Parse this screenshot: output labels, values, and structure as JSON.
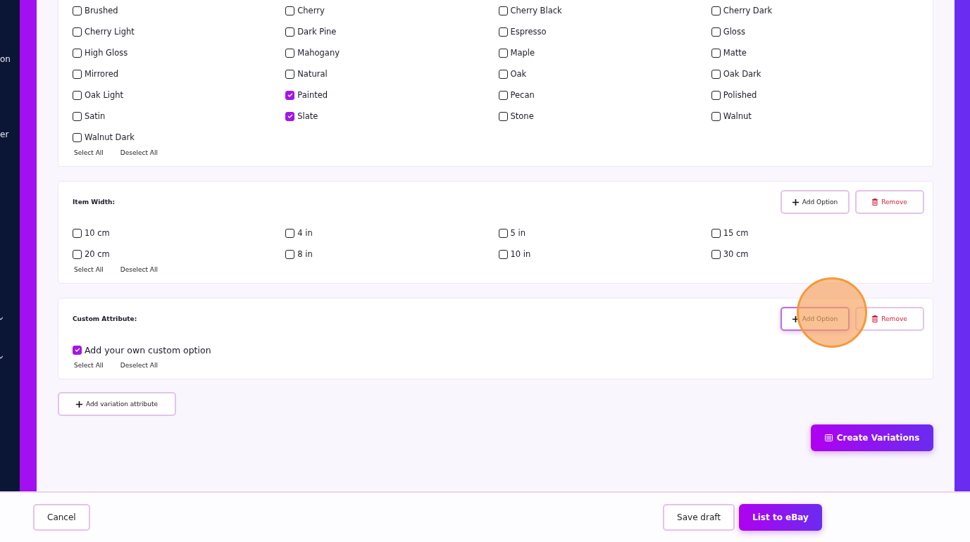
{
  "sidebar": {
    "items": [
      {
        "kind": "text",
        "label": "on"
      },
      {
        "kind": "text",
        "label": "er"
      },
      {
        "kind": "chevron"
      },
      {
        "kind": "chevron"
      }
    ]
  },
  "sections": [
    {
      "options": [
        {
          "label": "Brushed",
          "checked": false
        },
        {
          "label": "Cherry",
          "checked": false
        },
        {
          "label": "Cherry Black",
          "checked": false
        },
        {
          "label": "Cherry Dark",
          "checked": false
        },
        {
          "label": "Cherry Light",
          "checked": false
        },
        {
          "label": "Dark Pine",
          "checked": false
        },
        {
          "label": "Espresso",
          "checked": false
        },
        {
          "label": "Gloss",
          "checked": false
        },
        {
          "label": "High Gloss",
          "checked": false
        },
        {
          "label": "Mahogany",
          "checked": false
        },
        {
          "label": "Maple",
          "checked": false
        },
        {
          "label": "Matte",
          "checked": false
        },
        {
          "label": "Mirrored",
          "checked": false
        },
        {
          "label": "Natural",
          "checked": false
        },
        {
          "label": "Oak",
          "checked": false
        },
        {
          "label": "Oak Dark",
          "checked": false
        },
        {
          "label": "Oak Light",
          "checked": false
        },
        {
          "label": "Painted",
          "checked": true
        },
        {
          "label": "Pecan",
          "checked": false
        },
        {
          "label": "Polished",
          "checked": false
        },
        {
          "label": "Satin",
          "checked": false
        },
        {
          "label": "Slate",
          "checked": true
        },
        {
          "label": "Stone",
          "checked": false
        },
        {
          "label": "Walnut",
          "checked": false
        },
        {
          "label": "Walnut Dark",
          "checked": false
        }
      ],
      "select_all": "Select All",
      "deselect_all": "Deselect All"
    },
    {
      "title": "Item Width:",
      "add_option": "Add Option",
      "remove": "Remove",
      "highlighted": false,
      "options": [
        {
          "label": "10 cm",
          "checked": false
        },
        {
          "label": "4 in",
          "checked": false
        },
        {
          "label": "5 in",
          "checked": false
        },
        {
          "label": "15 cm",
          "checked": false
        },
        {
          "label": "20 cm",
          "checked": false
        },
        {
          "label": "8 in",
          "checked": false
        },
        {
          "label": "10 in",
          "checked": false
        },
        {
          "label": "30 cm",
          "checked": false
        }
      ],
      "select_all": "Select All",
      "deselect_all": "Deselect All"
    },
    {
      "title": "Custom Attribute:",
      "add_option": "Add Option",
      "remove": "Remove",
      "highlighted": true,
      "options": [
        {
          "label": "Add your own custom option",
          "checked": true
        }
      ],
      "select_all": "Select All",
      "deselect_all": "Deselect All"
    }
  ],
  "add_variation": "Add variation attribute",
  "create_variations": "Create Variations",
  "footer": {
    "cancel": "Cancel",
    "save_draft": "Save draft",
    "list": "List to eBay"
  }
}
